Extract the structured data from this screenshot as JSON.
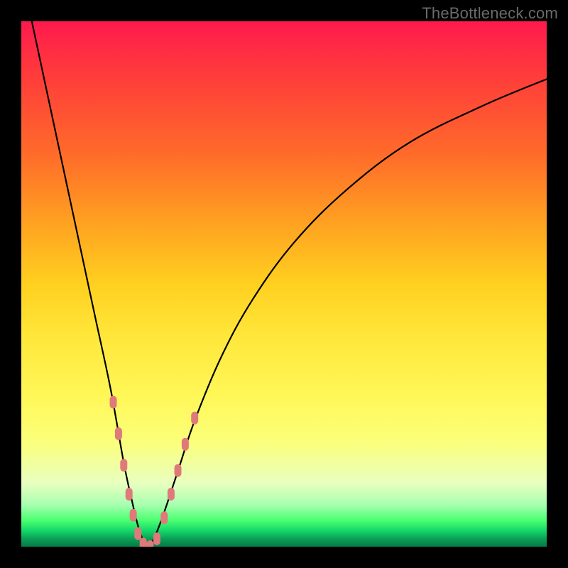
{
  "watermark": "TheBottleneck.com",
  "chart_data": {
    "type": "line",
    "title": "",
    "xlabel": "",
    "ylabel": "",
    "xlim": [
      0,
      1
    ],
    "ylim": [
      0,
      1
    ],
    "series": [
      {
        "name": "bottleneck-curve",
        "x": [
          0.02,
          0.05,
          0.08,
          0.11,
          0.14,
          0.17,
          0.195,
          0.21,
          0.225,
          0.24,
          0.25,
          0.27,
          0.3,
          0.33,
          0.38,
          0.44,
          0.52,
          0.62,
          0.74,
          0.88,
          1.0
        ],
        "values": [
          1.0,
          0.86,
          0.72,
          0.58,
          0.44,
          0.3,
          0.16,
          0.09,
          0.03,
          0.0,
          0.01,
          0.06,
          0.15,
          0.24,
          0.36,
          0.47,
          0.58,
          0.68,
          0.77,
          0.84,
          0.89
        ]
      }
    ],
    "markers": {
      "name": "highlight-dots",
      "color": "#e07a7a",
      "points": [
        {
          "x": 0.175,
          "y": 0.275
        },
        {
          "x": 0.185,
          "y": 0.215
        },
        {
          "x": 0.195,
          "y": 0.155
        },
        {
          "x": 0.205,
          "y": 0.1
        },
        {
          "x": 0.213,
          "y": 0.06
        },
        {
          "x": 0.222,
          "y": 0.025
        },
        {
          "x": 0.232,
          "y": 0.005
        },
        {
          "x": 0.245,
          "y": 0.0
        },
        {
          "x": 0.258,
          "y": 0.015
        },
        {
          "x": 0.272,
          "y": 0.055
        },
        {
          "x": 0.285,
          "y": 0.1
        },
        {
          "x": 0.298,
          "y": 0.145
        },
        {
          "x": 0.312,
          "y": 0.195
        },
        {
          "x": 0.33,
          "y": 0.245
        }
      ]
    },
    "gradient_stops": [
      {
        "pos": 0.0,
        "color": "#ff1a4d"
      },
      {
        "pos": 0.5,
        "color": "#ffd020"
      },
      {
        "pos": 0.8,
        "color": "#fbff7a"
      },
      {
        "pos": 1.0,
        "color": "#067a46"
      }
    ]
  }
}
